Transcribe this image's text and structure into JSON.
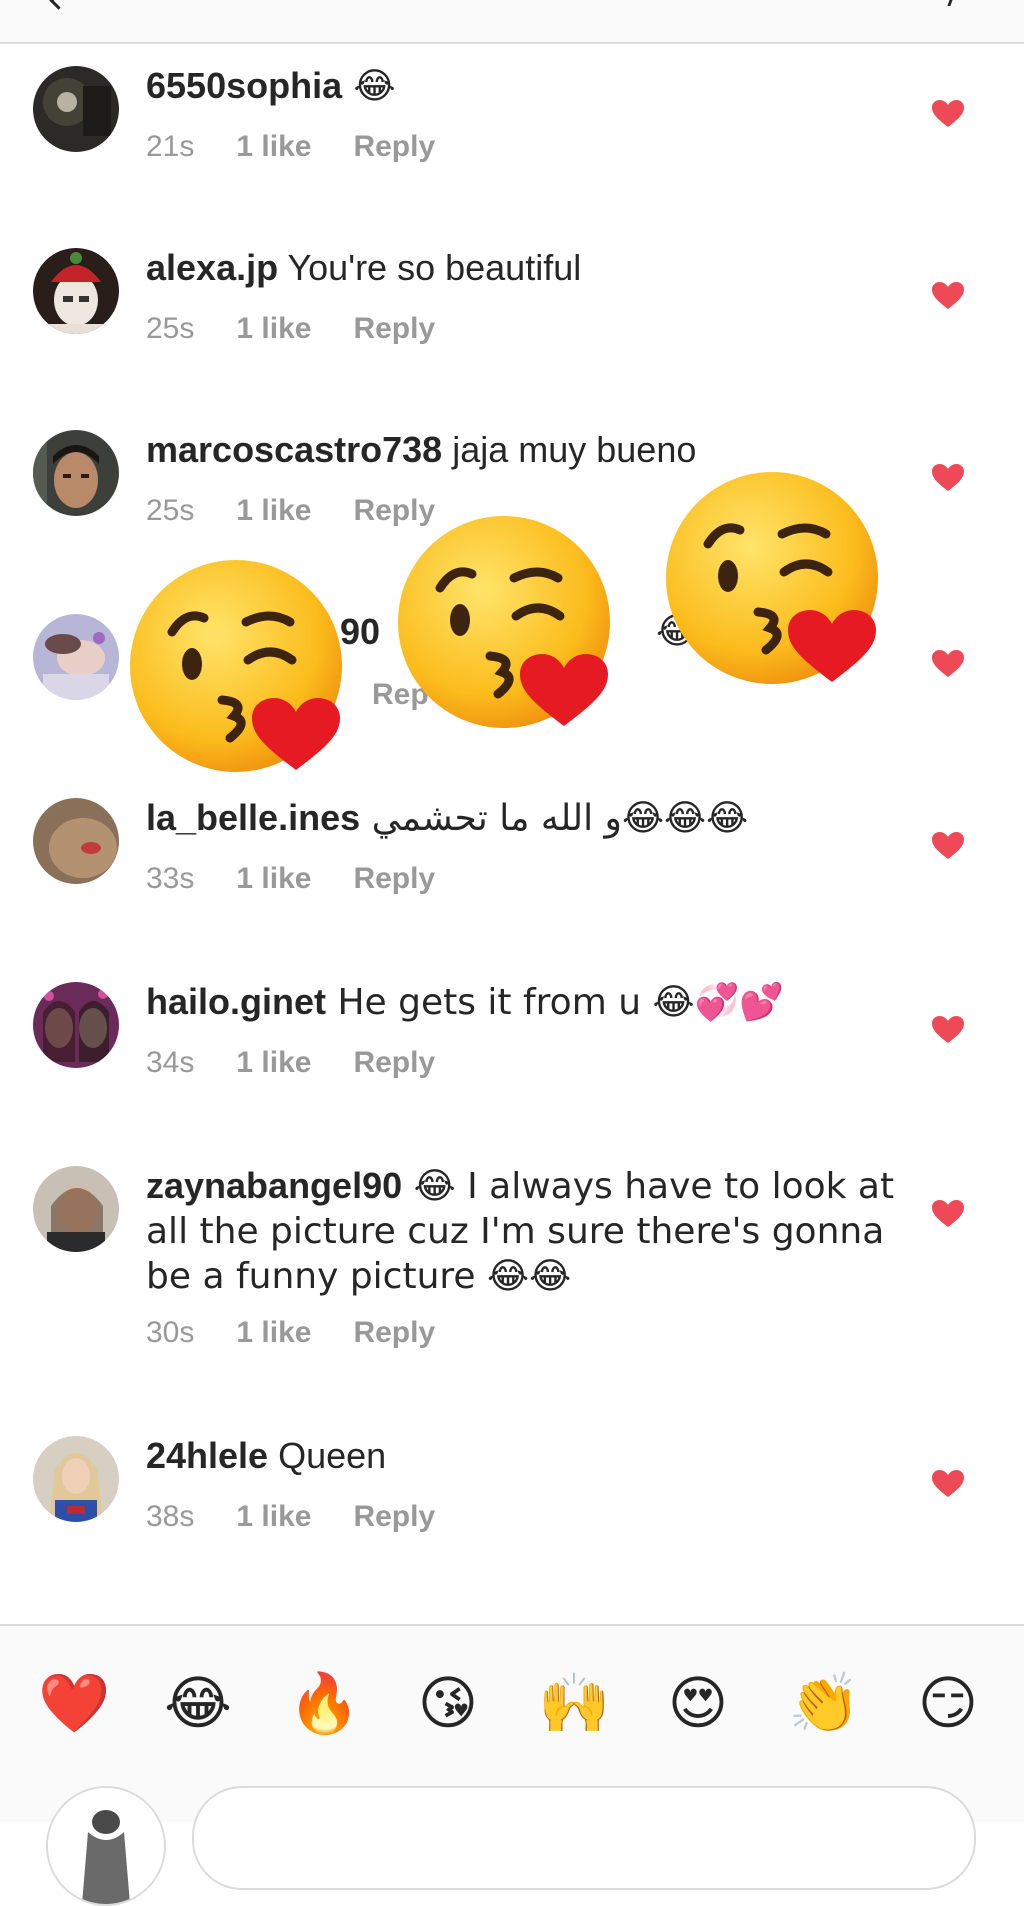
{
  "comments": [
    {
      "username": "6550sophia",
      "text": " 😂",
      "time": "21s",
      "likes": "1 like",
      "reply": "Reply"
    },
    {
      "username": "alexa.jp",
      "text": " You're so beautiful",
      "time": "25s",
      "likes": "1 like",
      "reply": "Reply"
    },
    {
      "username": "marcoscastro738",
      "text": " jaja muy bueno",
      "time": "25s",
      "likes": "1 like",
      "reply": "Reply"
    },
    {
      "username": "90",
      "text": "😂",
      "time": "",
      "likes": "",
      "reply": "Rep"
    },
    {
      "username": "la_belle.ines",
      "text": " و الله ما تحشمي😂😂😂",
      "time": "33s",
      "likes": "1 like",
      "reply": "Reply"
    },
    {
      "username": "hailo.ginet",
      "text": " He gets it from u 😂💞💕",
      "time": "34s",
      "likes": "1 like",
      "reply": "Reply"
    },
    {
      "username": "zaynabangel90",
      "text": " 😂 I always have to look at all the picture cuz I'm sure there's gonna be a funny picture 😂😂",
      "time": "30s",
      "likes": "1 like",
      "reply": "Reply"
    },
    {
      "username": "24hlele",
      "text": " Queen",
      "time": "38s",
      "likes": "1 like",
      "reply": "Reply"
    }
  ],
  "colors": {
    "heart": "#ed4956",
    "meta": "#999999",
    "text": "#262626",
    "divider": "#dbdbdb"
  },
  "icons": {
    "liked": "heart-icon",
    "back": "back-arrow-icon",
    "send": "send-icon"
  },
  "emoji_tray": [
    "❤️",
    "😂",
    "🔥",
    "😘",
    "🙌",
    "😍",
    "👏",
    "😏"
  ]
}
